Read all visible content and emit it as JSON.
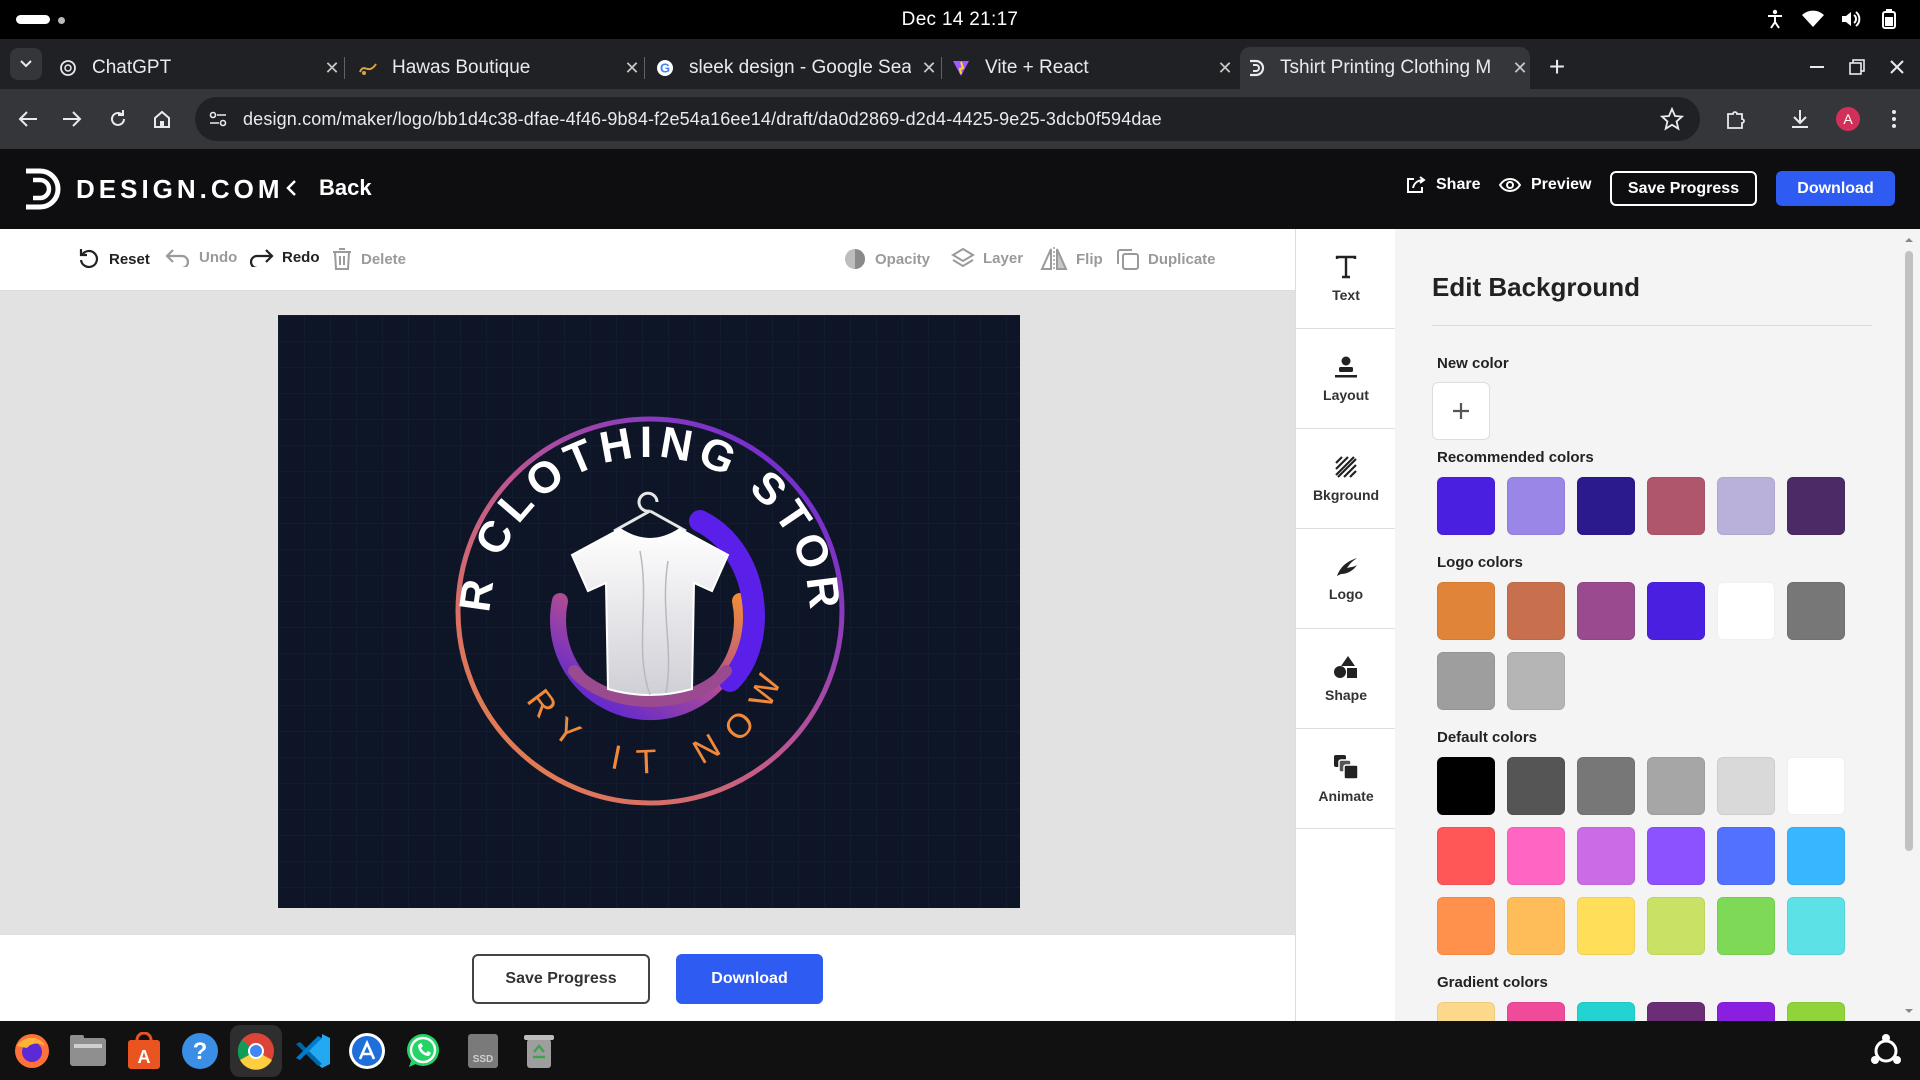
{
  "system": {
    "clock": "Dec 14  21:17"
  },
  "browser": {
    "tabs": [
      {
        "title": "ChatGPT",
        "icon": "openai-icon"
      },
      {
        "title": "Hawas Boutique",
        "icon": "boutique-icon"
      },
      {
        "title": "sleek design - Google Sea",
        "icon": "google-icon"
      },
      {
        "title": "Vite + React",
        "icon": "vite-icon"
      },
      {
        "title": "Tshirt Printing Clothing M",
        "icon": "design-com-icon",
        "active": true
      }
    ],
    "url": "design.com/maker/logo/bb1d4c38-dfae-4f46-9b84-f2e54a16ee14/draft/da0d2869-d2d4-4425-9e25-3dcb0f594dae",
    "profile_initial": "A"
  },
  "app": {
    "brand": "DESIGN.COM",
    "back_label": "Back",
    "share_label": "Share",
    "preview_label": "Preview",
    "save_label": "Save Progress",
    "download_label": "Download"
  },
  "toolbar": {
    "reset": "Reset",
    "undo": "Undo",
    "redo": "Redo",
    "delete": "Delete",
    "opacity": "Opacity",
    "layer": "Layer",
    "flip": "Flip",
    "duplicate": "Duplicate"
  },
  "canvas": {
    "logo_top_text": "AR CLOTHING STORE",
    "logo_bottom_text": "TRY IT NOW",
    "background_color": "#0d1526"
  },
  "bottom": {
    "save_label": "Save Progress",
    "download_label": "Download"
  },
  "side_tools": [
    "Text",
    "Layout",
    "Bkground",
    "Logo",
    "Shape",
    "Animate"
  ],
  "panel": {
    "title": "Edit Background",
    "new_color_label": "New color",
    "recommended_label": "Recommended colors",
    "logo_colors_label": "Logo colors",
    "default_label": "Default colors",
    "gradient_label": "Gradient colors",
    "recommended": [
      "#4a1fe0",
      "#9a86e6",
      "#2b1a8e",
      "#b0566c",
      "#b9b1d9",
      "#4b2a66"
    ],
    "logo_colors": [
      "#e0843a",
      "#c8704e",
      "#9a4a8f",
      "#4a1fe0",
      "#ffffff",
      "#777777",
      "#9e9e9e",
      "#b5b5b5"
    ],
    "default_colors": [
      "#000000",
      "#555555",
      "#777777",
      "#a6a6a6",
      "#d9d9d9",
      "#ffffff",
      "#ff5757",
      "#ff66c4",
      "#cb6ce6",
      "#8c52ff",
      "#5271ff",
      "#38b6ff",
      "#ff914d",
      "#ffbd59",
      "#ffde59",
      "#c9e265",
      "#7ed957",
      "#5ce1e6"
    ],
    "gradient_colors": [
      "#fbd88a",
      "#f04a9a",
      "#22d3d1",
      "#6b2d75",
      "#8a1fe0",
      "#8ed43a"
    ]
  }
}
